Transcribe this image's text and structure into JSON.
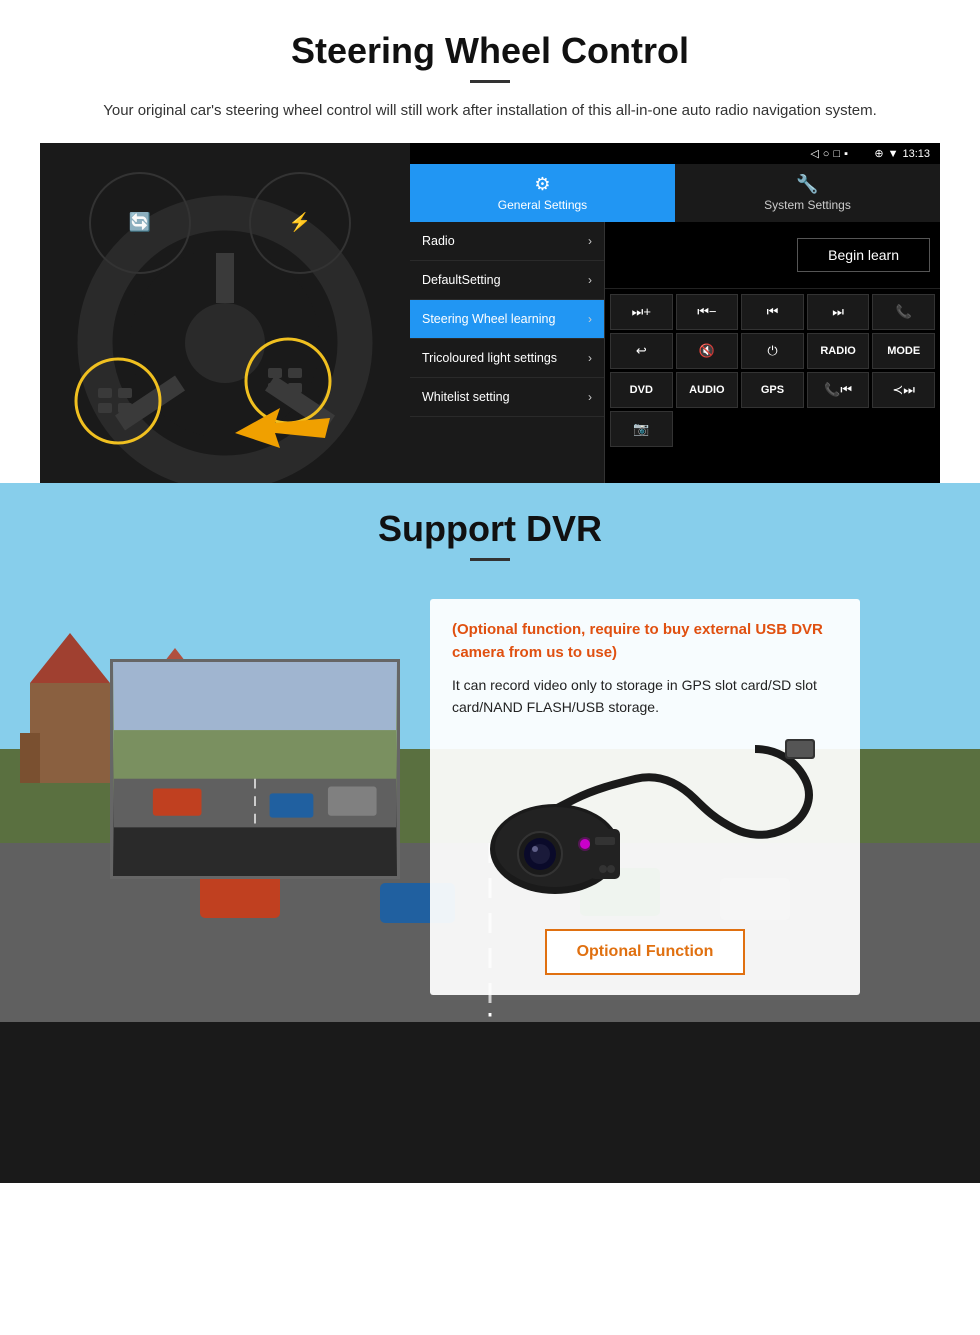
{
  "section1": {
    "title": "Steering Wheel Control",
    "subtitle": "Your original car's steering wheel control will still work after installation of this all-in-one auto radio navigation system.",
    "tabs": [
      {
        "id": "general",
        "icon": "⚙",
        "label": "General Settings",
        "active": true
      },
      {
        "id": "system",
        "icon": "🔧",
        "label": "System Settings",
        "active": false
      }
    ],
    "menu_items": [
      {
        "label": "Radio",
        "active": false
      },
      {
        "label": "DefaultSetting",
        "active": false
      },
      {
        "label": "Steering Wheel learning",
        "active": true
      },
      {
        "label": "Tricoloured light settings",
        "active": false
      },
      {
        "label": "Whitelist setting",
        "active": false
      }
    ],
    "begin_learn_label": "Begin learn",
    "control_buttons": [
      "⏭+",
      "⏮−",
      "⏮⏮",
      "⏭⏭",
      "📞",
      "↩",
      "🔇x",
      "⏻",
      "RADIO",
      "MODE",
      "DVD",
      "AUDIO",
      "GPS",
      "📞⏮",
      "≺⏭⏭"
    ],
    "status_bar": {
      "time": "13:13",
      "icons": [
        "▽",
        "▼",
        "□"
      ]
    }
  },
  "section2": {
    "title": "Support DVR",
    "optional_text": "(Optional function, require to buy external USB DVR camera from us to use)",
    "desc_text": "It can record video only to storage in GPS slot card/SD slot card/NAND FLASH/USB storage.",
    "optional_function_label": "Optional Function"
  }
}
